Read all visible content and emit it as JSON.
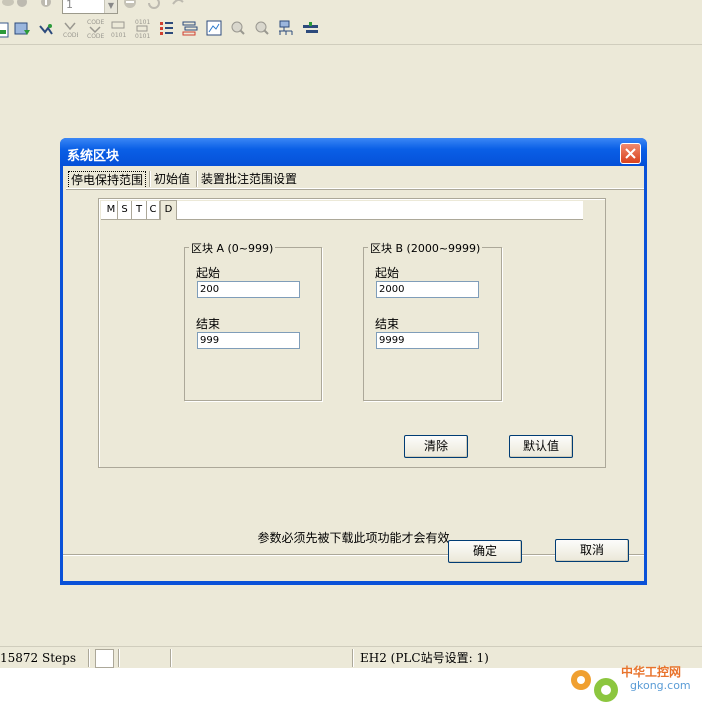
{
  "toolbar": {
    "selector_value": "1",
    "icons": [
      "eye-icon",
      "info-icon",
      "pause-icon",
      "refresh-icon",
      "redo-icon",
      "download-icon",
      "upload-icon",
      "monitor-icon",
      "code-icon",
      "code2-icon",
      "binary-icon",
      "bits-icon",
      "list-icon",
      "list2-icon",
      "chart-icon",
      "zoom-in-icon",
      "zoom-out-icon",
      "network-icon",
      "settings-icon"
    ]
  },
  "dialog": {
    "title": "系统区块",
    "tabs": [
      "停电保持范围",
      "初始值",
      "装置批注范围设置"
    ],
    "active_tab": 0,
    "inner_tabs": [
      "M",
      "S",
      "T",
      "C",
      "D"
    ],
    "inner_active": 4,
    "block_a": {
      "title": "区块 A (0~999)",
      "start_label": "起始",
      "start_value": "200",
      "end_label": "结束",
      "end_value": "999"
    },
    "block_b": {
      "title": "区块 B (2000~9999)",
      "start_label": "起始",
      "start_value": "2000",
      "end_label": "结束",
      "end_value": "9999"
    },
    "clear_button": "清除",
    "default_button": "默认值",
    "note": "参数必须先被下载此项功能才会有效",
    "ok_button": "确定",
    "cancel_button": "取消"
  },
  "statusbar": {
    "steps": "15872 Steps",
    "plc": "EH2 (PLC站号设置: 1)"
  },
  "watermark": {
    "cn": "中华工控网",
    "en": "gkong.com"
  },
  "colors": {
    "titlebar": "#0a5fe6",
    "background": "#ece9d8",
    "close": "#d9411d"
  }
}
